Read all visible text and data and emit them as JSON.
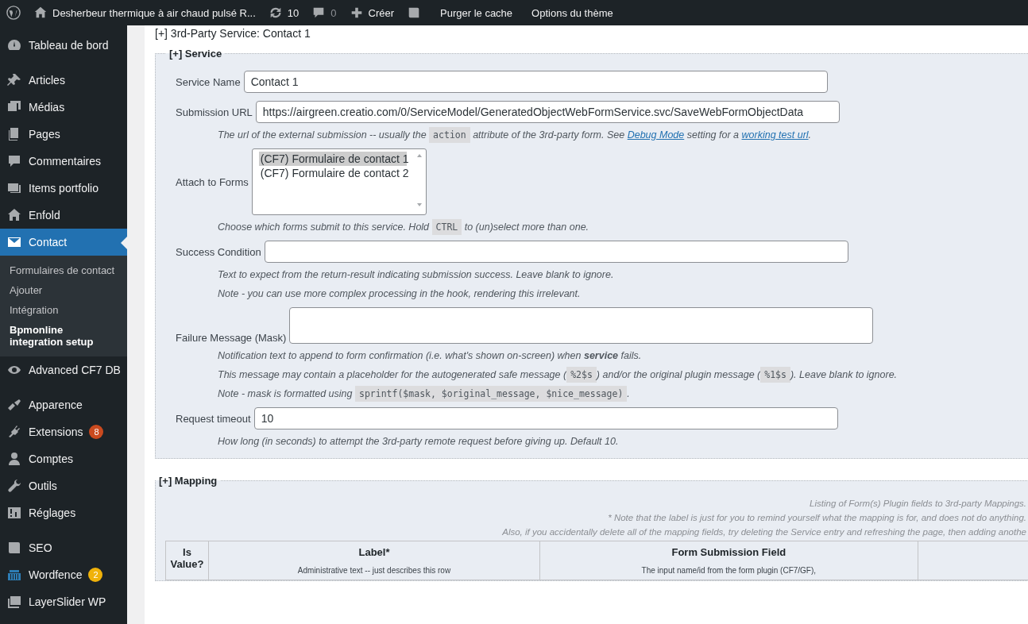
{
  "admin_bar": {
    "site_title": "Desherbeur thermique à air chaud pulsé R...",
    "updates": "10",
    "comments": "0",
    "new_label": "Créer",
    "links": [
      "Purger le cache",
      "Options du thème"
    ]
  },
  "sidebar": {
    "groups": [
      [
        {
          "label": "Tableau de bord",
          "selected": false
        }
      ],
      [
        {
          "label": "Articles",
          "selected": false
        },
        {
          "label": "Médias",
          "selected": false
        },
        {
          "label": "Pages",
          "selected": false
        },
        {
          "label": "Commentaires",
          "selected": false
        },
        {
          "label": "Items portfolio",
          "selected": false
        },
        {
          "label": "Enfold",
          "selected": false
        },
        {
          "label": "Contact",
          "selected": true,
          "children": [
            {
              "label": "Formulaires de contact",
              "selected": false
            },
            {
              "label": "Ajouter",
              "selected": false
            },
            {
              "label": "Intégration",
              "selected": false
            },
            {
              "label": "Bpmonline integration setup",
              "selected": true
            }
          ]
        },
        {
          "label": "Advanced CF7 DB",
          "selected": false
        }
      ],
      [
        {
          "label": "Apparence",
          "selected": false
        },
        {
          "label": "Extensions",
          "selected": false,
          "badge": {
            "text": "8",
            "color": "#ca4a1f"
          }
        },
        {
          "label": "Comptes",
          "selected": false
        },
        {
          "label": "Outils",
          "selected": false
        },
        {
          "label": "Réglages",
          "selected": false
        }
      ],
      [
        {
          "label": "SEO",
          "selected": false
        },
        {
          "label": "Wordfence",
          "selected": false,
          "badge": {
            "text": "2",
            "color": "#f0b20a"
          }
        },
        {
          "label": "LayerSlider WP",
          "selected": false
        }
      ]
    ]
  },
  "section_title": "[+] 3rd-Party Service: Contact 1",
  "service": {
    "legend": "[+] Service",
    "fields": [
      {
        "kind": "text",
        "label": "Service Name",
        "value": "Contact 1"
      },
      {
        "kind": "text",
        "label": "Submission URL",
        "value": "https://airgreen.creatio.com/0/ServiceModel/GeneratedObjectWebFormService.svc/SaveWebFormObjectData",
        "help": [
          [
            {
              "kind": "text",
              "text": "The url of the external submission -- usually the "
            },
            {
              "kind": "code",
              "text": "action"
            },
            {
              "kind": "text",
              "text": " attribute of the 3rd-party form. See "
            },
            {
              "kind": "link",
              "text": "Debug Mode"
            },
            {
              "kind": "text",
              "text": " setting for a "
            },
            {
              "kind": "link",
              "text": "working test url"
            },
            {
              "kind": "text",
              "text": "."
            }
          ]
        ]
      },
      {
        "kind": "listbox",
        "label": "Attach to Forms",
        "options": [
          {
            "label": "(CF7) Formulaire de contact 1",
            "selected": true
          },
          {
            "label": "(CF7) Formulaire de contact 2",
            "selected": false
          }
        ],
        "help": [
          [
            {
              "kind": "text",
              "text": "Choose which forms submit to this service. Hold "
            },
            {
              "kind": "code",
              "text": "CTRL"
            },
            {
              "kind": "text",
              "text": " to (un)select more than one."
            }
          ]
        ]
      },
      {
        "kind": "text",
        "label": "Success Condition",
        "help": [
          [
            {
              "kind": "text",
              "text": "Text to expect from the return-result indicating submission success. Leave blank to ignore."
            }
          ],
          [
            {
              "kind": "text",
              "text": "Note - you can use more complex processing in the hook, rendering this irrelevant."
            }
          ]
        ]
      },
      {
        "kind": "textarea",
        "label": "Failure Message (Mask)",
        "help": [
          [
            {
              "kind": "text",
              "text": "Notification text to append to form confirmation (i.e. what's shown on-screen) when **service** fails."
            }
          ],
          [
            {
              "kind": "text",
              "text": "This message may contain a placeholder for the autogenerated safe message ("
            },
            {
              "kind": "code",
              "text": "%2$s"
            },
            {
              "kind": "text",
              "text": ") and/or the original plugin message ("
            },
            {
              "kind": "code",
              "text": "%1$s"
            },
            {
              "kind": "text",
              "text": "). Leave blank to ignore."
            }
          ],
          [
            {
              "kind": "text",
              "text": "Note - mask is formatted using "
            },
            {
              "kind": "code",
              "text": "sprintf($mask, $original_message, $nice_message)"
            },
            {
              "kind": "text",
              "text": "."
            }
          ]
        ]
      },
      {
        "kind": "text",
        "label": "Request timeout",
        "value": "10",
        "help": [
          [
            {
              "kind": "text",
              "text": "How long (in seconds) to attempt the 3rd-party remote request before giving up. Default 10."
            }
          ]
        ]
      }
    ]
  },
  "mapping": {
    "legend": "[+] Mapping",
    "notes": [
      "Listing of Form(s) Plugin fields to 3rd-party Mappings.",
      "* Note that the label is just for you to remind yourself what the mapping is for, and does not do anything.",
      "Also, if you accidentally delete all of the mapping fields, try deleting the Service entry and refreshing the page, then adding anothe"
    ],
    "columns": [
      {
        "title": "Is Value?"
      },
      {
        "title": "Label*",
        "subtitle": "Administrative text -- just describes this row"
      },
      {
        "title": "Form Submission Field",
        "subtitle": "The input name/id from the form plugin (CF7/GF),"
      }
    ]
  }
}
